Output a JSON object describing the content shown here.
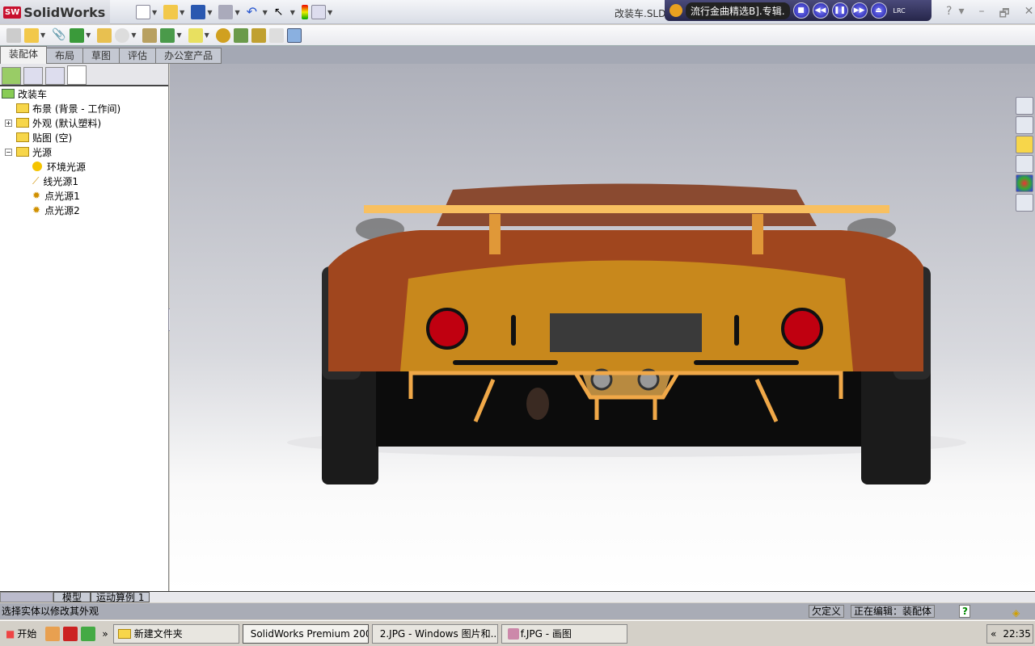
{
  "app": {
    "name": "SolidWorks",
    "document_title": "改装车.SLD"
  },
  "player": {
    "song": "流行金曲精选B].专辑.",
    "lrc": "LRC",
    "buttons": [
      "stop",
      "rewind",
      "pause",
      "forward",
      "eject"
    ]
  },
  "window_controls": [
    "?",
    "▾",
    "–",
    "🗗",
    "✕"
  ],
  "tabs": [
    {
      "label": "装配体",
      "active": true
    },
    {
      "label": "布局"
    },
    {
      "label": "草图"
    },
    {
      "label": "评估"
    },
    {
      "label": "办公室产品"
    }
  ],
  "tree": {
    "root": "改装车",
    "items": [
      {
        "label": "布景 (背景 - 工作间)",
        "icon": "folder-icon",
        "level": 1
      },
      {
        "label": "外观 (默认塑料)",
        "icon": "folder-icon",
        "level": 1,
        "expandable": true
      },
      {
        "label": "贴图 (空)",
        "icon": "folder-icon",
        "level": 1
      },
      {
        "label": "光源",
        "icon": "folder-light-icon",
        "level": 1,
        "expanded": true
      },
      {
        "label": "环境光源",
        "icon": "bulb-icon",
        "level": 2
      },
      {
        "label": "线光源1",
        "icon": "directional-light-icon",
        "level": 2
      },
      {
        "label": "点光源1",
        "icon": "point-light-icon",
        "level": 2
      },
      {
        "label": "点光源2",
        "icon": "point-light-icon",
        "level": 2
      }
    ]
  },
  "bottom_tabs": [
    "模型",
    "运动算例 1"
  ],
  "status": {
    "message": "选择实体以修改其外观",
    "definition": "欠定义",
    "editing": "正在编辑：装配体"
  },
  "taskbar": {
    "start": "开始",
    "more": "»",
    "items": [
      {
        "label": "新建文件夹"
      },
      {
        "label": "SolidWorks Premium 200...",
        "active": true
      },
      {
        "label": "2.JPG - Windows 图片和..."
      },
      {
        "label": "f.JPG - 画图"
      }
    ],
    "tray_expand": "«",
    "clock": "22:35"
  },
  "colors": {
    "car_body": "#a0461e",
    "spoiler": "#f0b050",
    "taillight": "#c00010"
  }
}
